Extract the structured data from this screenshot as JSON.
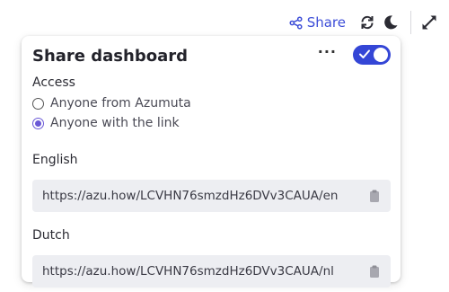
{
  "toolbar": {
    "share_label": "Share",
    "icons": [
      "share-nodes-icon",
      "refresh-icon",
      "moon-icon",
      "expand-icon"
    ]
  },
  "panel": {
    "title": "Share dashboard",
    "more_label": "···",
    "toggle_enabled": true,
    "access_label": "Access",
    "options": [
      {
        "label": "Anyone from Azumuta",
        "selected": false
      },
      {
        "label": "Anyone with the link",
        "selected": true
      }
    ],
    "links": [
      {
        "language": "English",
        "url": "https://azu.how/LCVHN76smzdHz6DVv3CAUA/en"
      },
      {
        "language": "Dutch",
        "url": "https://azu.how/LCVHN76smzdHz6DVv3CAUA/nl"
      }
    ]
  },
  "colors": {
    "accent": "#3446d6",
    "radio_accent": "#6a58d6",
    "link_bg": "#edeef2"
  }
}
